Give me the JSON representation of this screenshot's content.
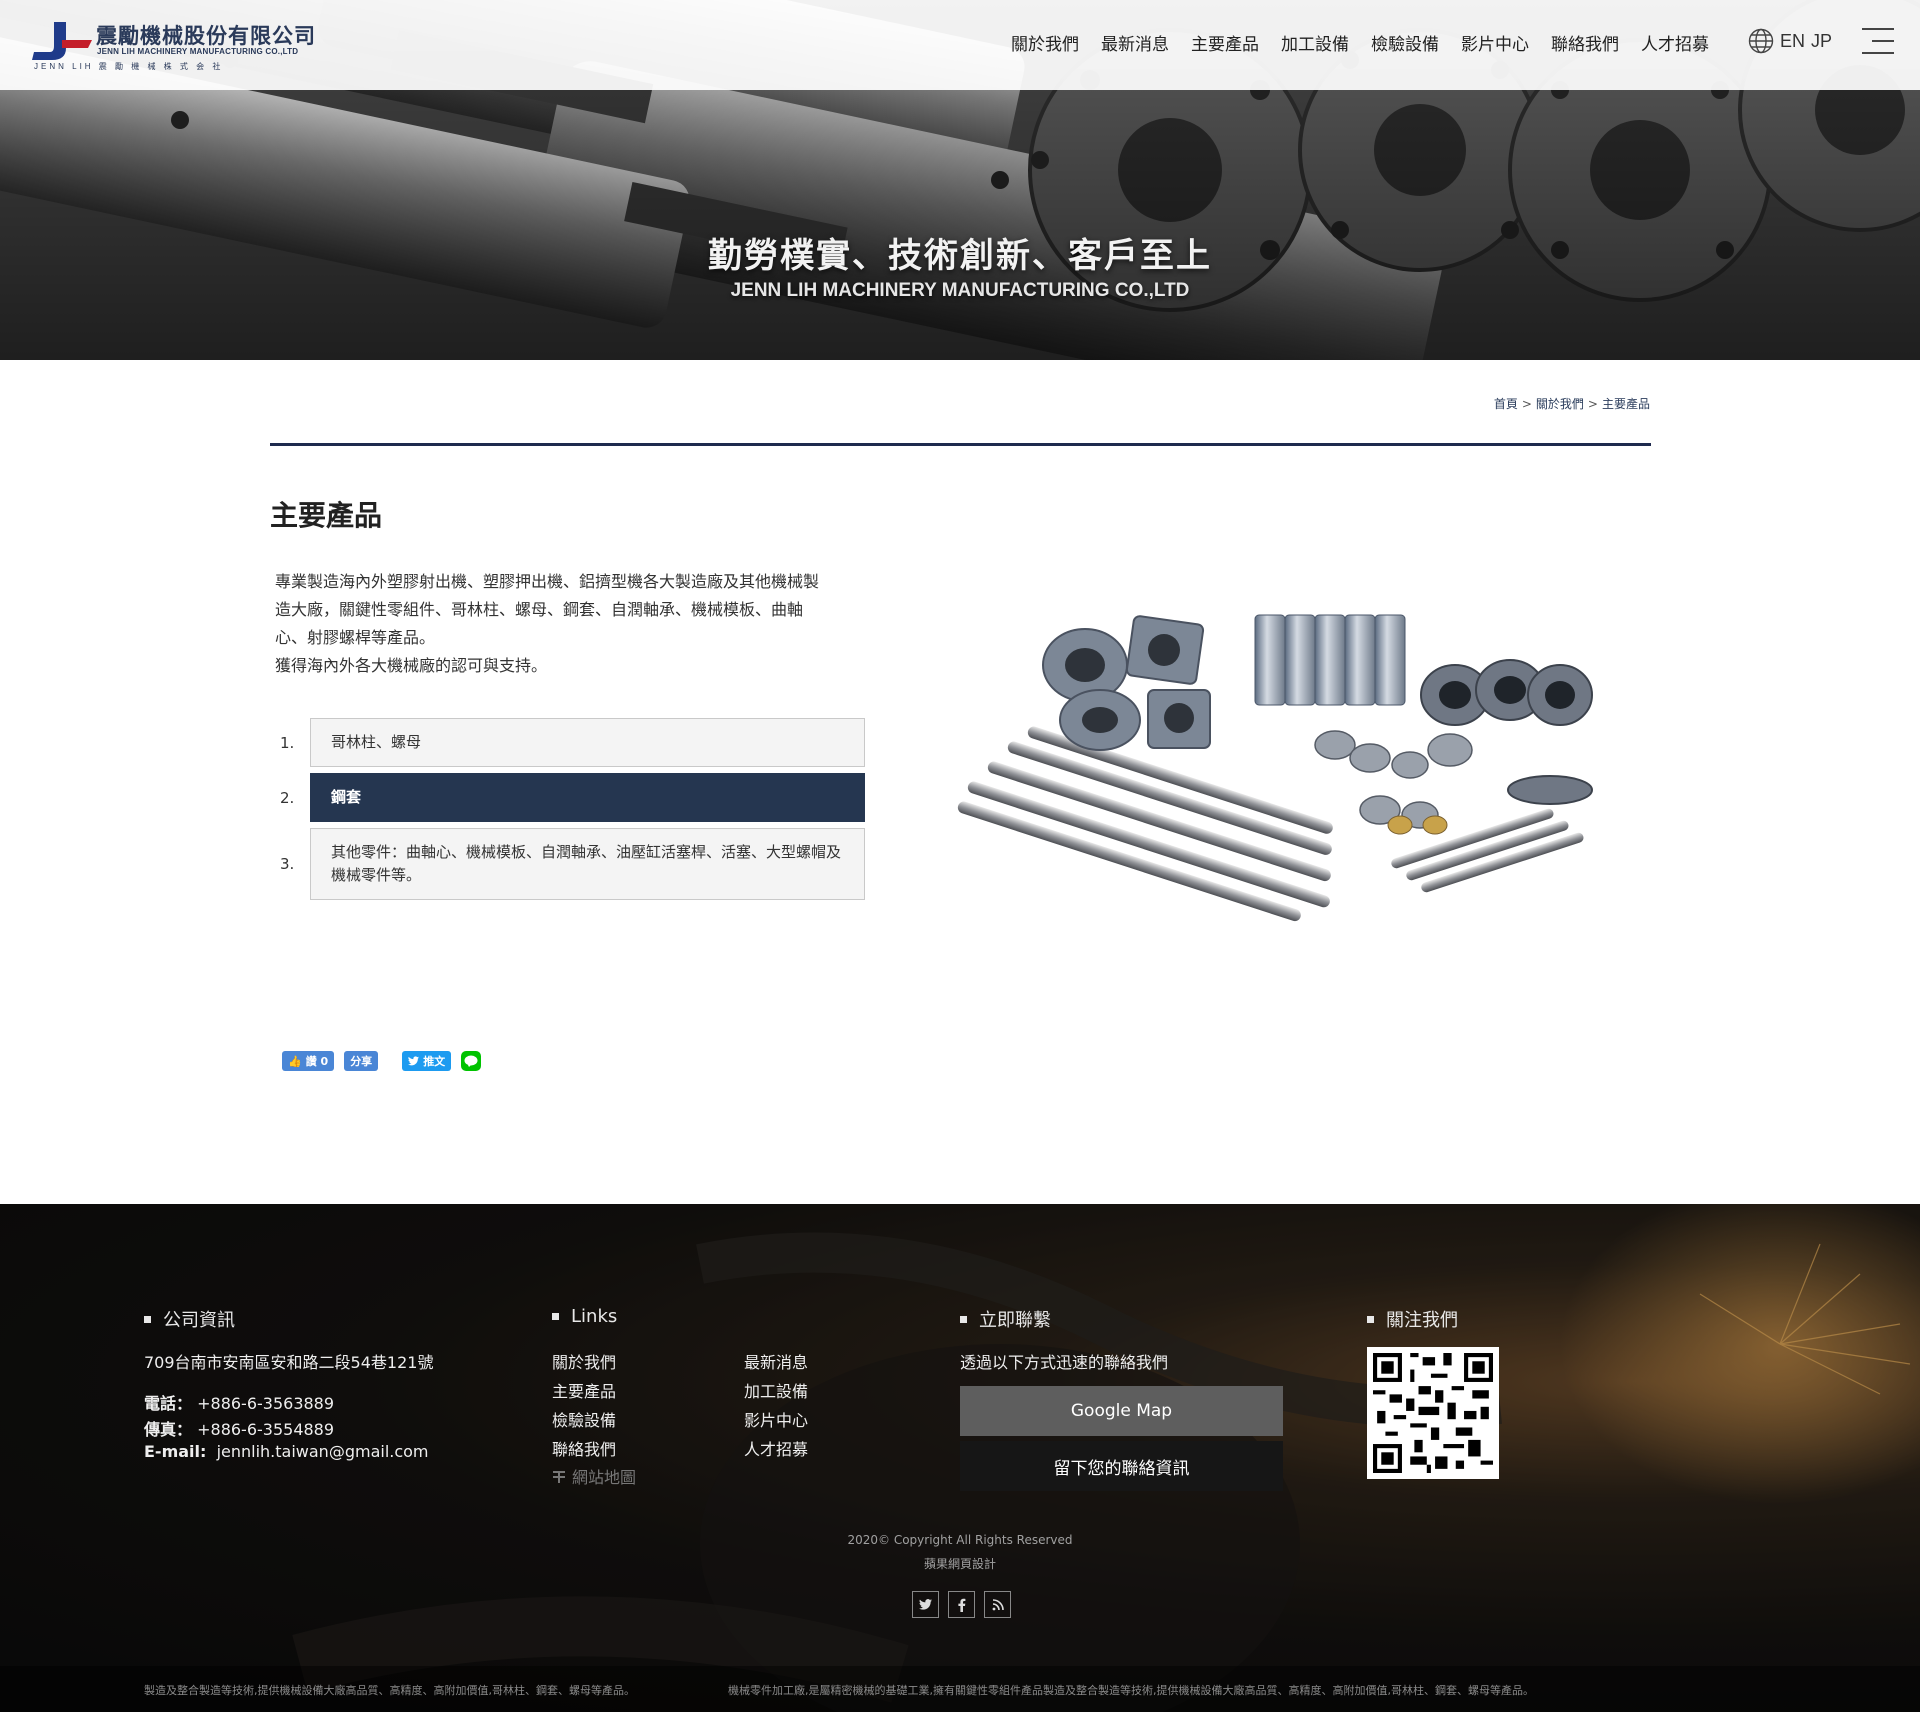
{
  "header": {
    "logo_cn": "震勵機械股份有限公司",
    "logo_en": "JENN LIH MACHINERY MANUFACTURING CO.,LTD",
    "logo_sub": "JENN LIH 震 勵 機 械 株 式 会 社",
    "nav": [
      "關於我們",
      "最新消息",
      "主要產品",
      "加工設備",
      "檢驗設備",
      "影片中心",
      "聯絡我們",
      "人才招募"
    ],
    "lang_en": "EN",
    "lang_jp": "JP"
  },
  "banner": {
    "title": "勤勞樸實、技術創新、客戶至上",
    "subtitle": "JENN LIH MACHINERY MANUFACTURING CO.,LTD"
  },
  "breadcrumb": [
    "首頁",
    "關於我們",
    "主要產品"
  ],
  "page": {
    "title": "主要產品",
    "intro": [
      "專業製造海內外塑膠射出機、塑膠押出機、鋁擠型機各大製造廠及其他機械製",
      "造大廠，關鍵性零組件、哥林柱、螺母、鋼套、自潤軸承、機械模板、曲軸",
      "心、射膠螺桿等產品。",
      "獲得海內外各大機械廠的認可與支持。"
    ],
    "products": [
      {
        "num": "1.",
        "label": "哥林柱、螺母",
        "active": false
      },
      {
        "num": "2.",
        "label": "鋼套",
        "active": true
      },
      {
        "num": "3.",
        "label": "其他零件：曲軸心、機械模板、自潤軸承、油壓缸活塞桿、活塞、大型螺帽及機械零件等。",
        "active": false
      }
    ]
  },
  "share": {
    "like": "讚 0",
    "share": "分享",
    "tweet": "推文"
  },
  "footer": {
    "company_title": "公司資訊",
    "address": "709台南市安南區安和路二段54巷121號",
    "tel_label": "電話：",
    "tel": "+886-6-3563889",
    "fax_label": "傳真：",
    "fax": "+886-6-3554889",
    "email_label": "E-mail:",
    "email": "jennlih.taiwan@gmail.com",
    "links_title": "Links",
    "links_col1": [
      "關於我們",
      "主要產品",
      "檢驗設備",
      "聯絡我們"
    ],
    "links_col2": [
      "最新消息",
      "加工設備",
      "影片中心",
      "人才招募"
    ],
    "sitemap": "網站地圖",
    "contact_title": "立即聯繫",
    "contact_text": "透過以下方式迅速的聯絡我們",
    "gmap_button": "Google Map",
    "contact_button": "留下您的聯絡資訊",
    "follow_title": "關注我們",
    "copyright": "2020© Copyright All Rights Reserved",
    "designer": "蘋果網頁設計",
    "bottom_left": "製造及整合製造等技術,提供機械設備大廠高品質、高精度、高附加價值,哥林柱、鋼套、螺母等產品。",
    "bottom_right": "機械零件加工廠,是屬精密機械的基礎工業,擁有關鍵性零組件產品製造及整合製造等技術,提供機械設備大廠高品質、高精度、高附加價值,哥林柱、鋼套、螺母等產品。"
  },
  "colors": {
    "accent": "#253650",
    "divider": "#1e2a4e",
    "facebook": "#4a86d6",
    "twitter": "#1d9bf0",
    "line": "#00c300"
  },
  "icons": [
    "globe-icon",
    "hamburger-icon",
    "facebook-like-icon",
    "twitter-icon",
    "line-icon",
    "sitemap-icon",
    "twitter-icon",
    "facebook-icon",
    "rss-icon"
  ]
}
